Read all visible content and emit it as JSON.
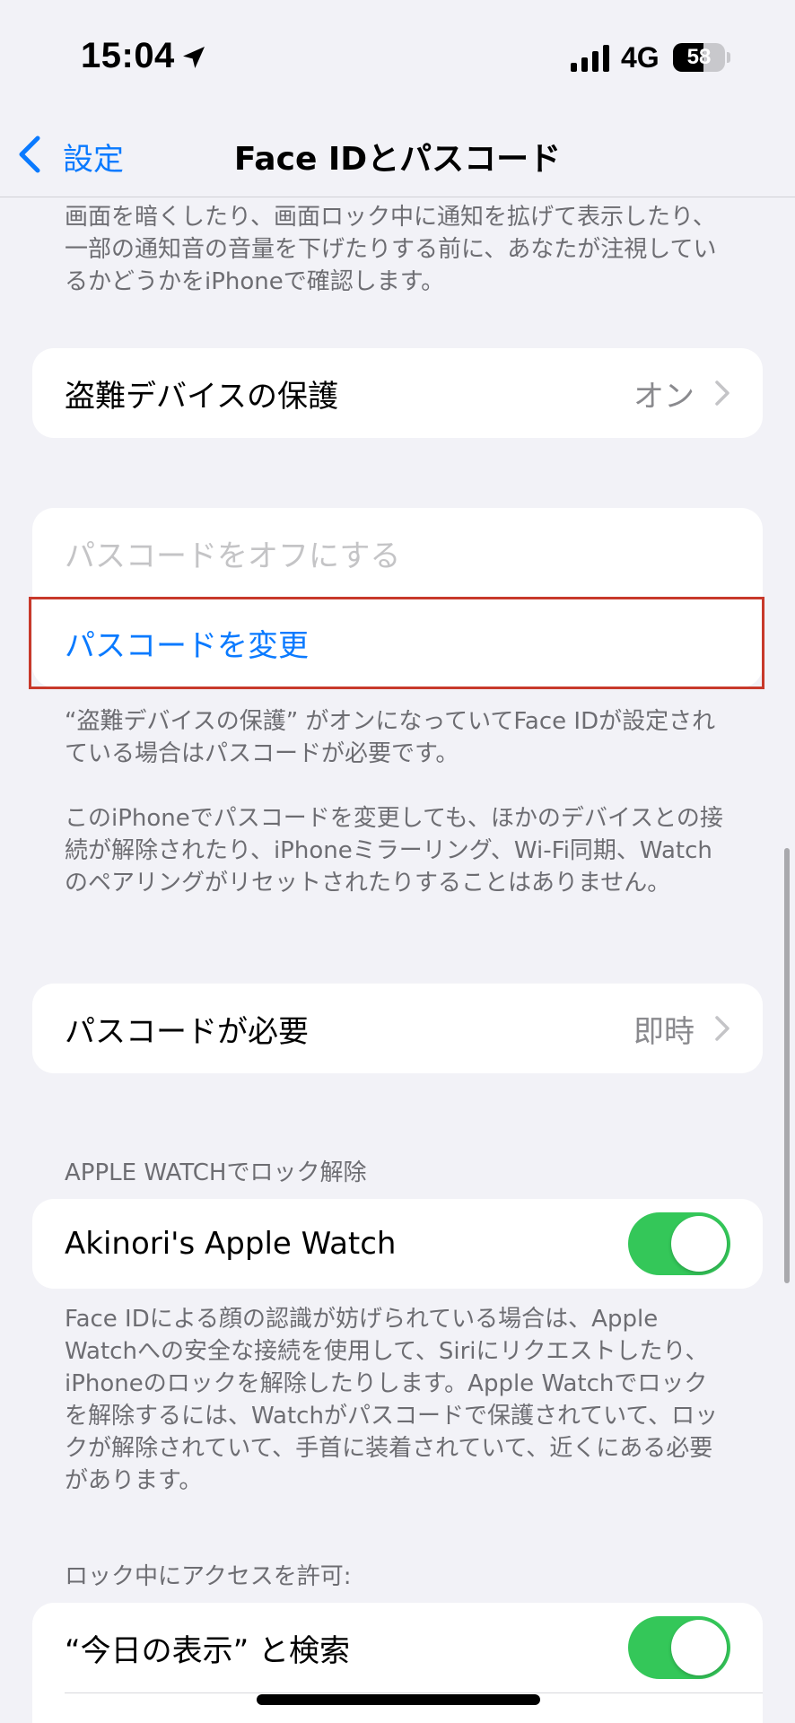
{
  "status_bar": {
    "time": "15:04",
    "network": "4G",
    "battery_percent": "58",
    "battery_level": 0.58
  },
  "nav": {
    "back_label": "設定",
    "title": "Face IDとパスコード"
  },
  "attention_footer": "画面を暗くしたり、画面ロック中に通知を拡げて表示したり、一部の通知音の音量を下げたりする前に、あなたが注視しているかどうかをiPhoneで確認します。",
  "stolen_device": {
    "label": "盗難デバイスの保護",
    "value": "オン"
  },
  "passcode_group": {
    "turn_off_label": "パスコードをオフにする",
    "change_label": "パスコードを変更"
  },
  "passcode_footer_1": "“盗難デバイスの保護” がオンになっていてFace IDが設定されている場合はパスコードが必要です。",
  "passcode_footer_2": "このiPhoneでパスコードを変更しても、ほかのデバイスとの接続が解除されたり、iPhoneミラーリング、Wi-Fi同期、Watchのペアリングがリセットされたりすることはありません。",
  "require_passcode": {
    "label": "パスコードが必要",
    "value": "即時"
  },
  "apple_watch_section": {
    "header": "APPLE WATCHでロック解除",
    "watch_label": "Akinori's Apple Watch",
    "watch_enabled": true,
    "footer": "Face IDによる顔の認識が妨げられている場合は、Apple Watchへの安全な接続を使用して、Siriにリクエストしたり、iPhoneのロックを解除したりします。Apple Watchでロックを解除するには、Watchがパスコードで保護されていて、ロックが解除されていて、手首に装着されていて、近くにある必要があります。"
  },
  "lock_access_section": {
    "header": "ロック中にアクセスを許可:",
    "today_label": "“今日の表示” と検索",
    "today_enabled": true
  },
  "colors": {
    "accent": "#0a7aff",
    "toggle_on": "#34c759",
    "highlight_border": "#c8392b"
  }
}
